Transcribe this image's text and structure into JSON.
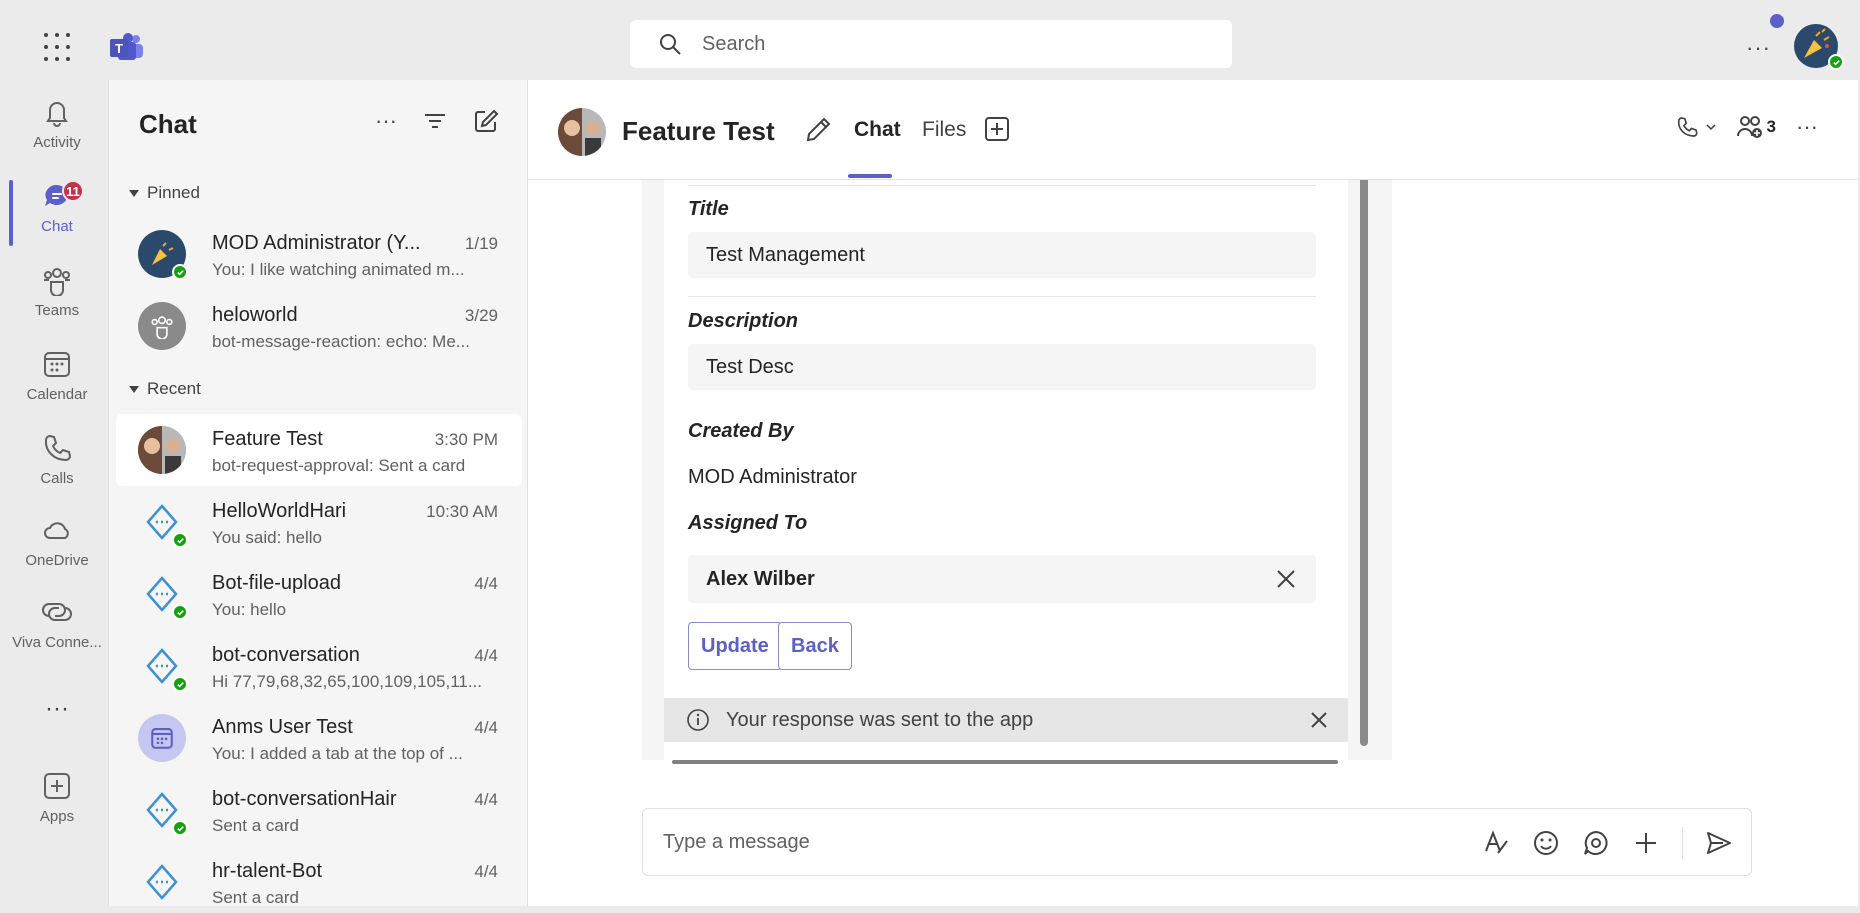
{
  "app": {
    "search_placeholder": "Search",
    "more": "···"
  },
  "rail": {
    "items": [
      {
        "label": "Activity",
        "icon": "bell-icon"
      },
      {
        "label": "Chat",
        "icon": "chat-icon",
        "badge": "11"
      },
      {
        "label": "Teams",
        "icon": "teams-icon"
      },
      {
        "label": "Calendar",
        "icon": "calendar-icon"
      },
      {
        "label": "Calls",
        "icon": "phone-icon"
      },
      {
        "label": "OneDrive",
        "icon": "cloud-icon"
      },
      {
        "label": "Viva Conne...",
        "icon": "viva-icon"
      },
      {
        "label": "Apps",
        "icon": "apps-add-icon"
      }
    ],
    "more": "···"
  },
  "chat_list": {
    "title": "Chat",
    "pinned_label": "Pinned",
    "recent_label": "Recent",
    "pinned": [
      {
        "name": "MOD Administrator (Y...",
        "time": "1/19",
        "preview": "You: I like watching animated m..."
      },
      {
        "name": "heloworld",
        "time": "3/29",
        "preview": "bot-message-reaction: echo: Me..."
      }
    ],
    "recent": [
      {
        "name": "Feature Test",
        "time": "3:30 PM",
        "preview": "bot-request-approval: Sent a card"
      },
      {
        "name": "HelloWorldHari",
        "time": "10:30 AM",
        "preview": "You said: hello"
      },
      {
        "name": "Bot-file-upload",
        "time": "4/4",
        "preview": "You: hello"
      },
      {
        "name": "bot-conversation",
        "time": "4/4",
        "preview": "Hi 77,79,68,32,65,100,109,105,11..."
      },
      {
        "name": "Anms User Test",
        "time": "4/4",
        "preview": "You: I added a tab at the top of ..."
      },
      {
        "name": "bot-conversationHair",
        "time": "4/4",
        "preview": "Sent a card"
      },
      {
        "name": "hr-talent-Bot",
        "time": "4/4",
        "preview": "Sent a card"
      }
    ]
  },
  "conversation": {
    "title": "Feature Test",
    "tabs": [
      "Chat",
      "Files"
    ],
    "participants": "3"
  },
  "card": {
    "title_label": "Title",
    "title_value": "Test Management",
    "description_label": "Description",
    "description_value": "Test Desc",
    "created_by_label": "Created By",
    "created_by_value": "MOD Administrator",
    "assigned_to_label": "Assigned To",
    "assigned_to_value": "Alex Wilber",
    "update_button": "Update",
    "back_button": "Back",
    "response_message": "Your response was sent to the app"
  },
  "compose": {
    "placeholder": "Type a message"
  },
  "colors": {
    "accent": "#5b5fc7",
    "badge": "#c4314b",
    "presence": "#13a10e"
  }
}
